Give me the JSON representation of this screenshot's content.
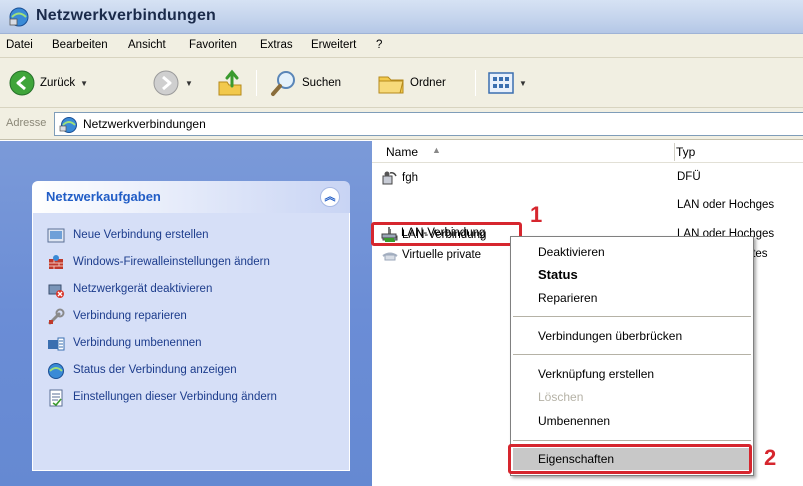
{
  "window": {
    "title": "Netzwerkverbindungen"
  },
  "menubar": {
    "items": [
      "Datei",
      "Bearbeiten",
      "Ansicht",
      "Favoriten",
      "Extras",
      "Erweitert",
      "?"
    ]
  },
  "toolbar": {
    "back_label": "Zurück",
    "search_label": "Suchen",
    "folders_label": "Ordner"
  },
  "address": {
    "label": "Adresse",
    "value": "Netzwerkverbindungen"
  },
  "tasks": {
    "title": "Netzwerkaufgaben",
    "items": [
      {
        "label": "Neue Verbindung erstellen",
        "icon": "new-connection-icon"
      },
      {
        "label": "Windows-Firewalleinstellungen ändern",
        "icon": "firewall-icon"
      },
      {
        "label": "Netzwerkgerät deaktivieren",
        "icon": "disable-device-icon"
      },
      {
        "label": "Verbindung reparieren",
        "icon": "repair-icon"
      },
      {
        "label": "Verbindung umbenennen",
        "icon": "rename-icon"
      },
      {
        "label": "Status der Verbindung anzeigen",
        "icon": "status-icon"
      },
      {
        "label": "Einstellungen dieser Verbindung ändern",
        "icon": "settings-icon"
      }
    ]
  },
  "list": {
    "columns": {
      "name": "Name",
      "type": "Typ"
    },
    "rows": [
      {
        "name": "fgh",
        "type": "DFÜ",
        "icon": "dialup-icon"
      },
      {
        "name": "LAN-Verbindung",
        "type": "LAN oder Hochges",
        "icon": "lan-icon"
      },
      {
        "name": "LAN-Verbindung",
        "type": "LAN oder Hochges",
        "icon": "lan-icon"
      },
      {
        "name": "Virtuelle private",
        "type": "Virtuelles privates",
        "icon": "vpn-icon"
      }
    ]
  },
  "context_menu": {
    "items": [
      "Deaktivieren",
      "Status",
      "Reparieren",
      "Verbindungen überbrücken",
      "Verknüpfung erstellen",
      "Löschen",
      "Umbenennen",
      "Eigenschaften"
    ]
  },
  "annotations": {
    "step1": "1",
    "step2": "2"
  },
  "colors": {
    "accent_red": "#d6262e",
    "task_blue": "#215dc6",
    "pane_blue": "#6b8dd6"
  }
}
